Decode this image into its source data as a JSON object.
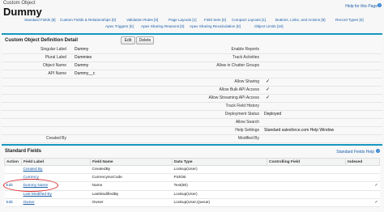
{
  "header": {
    "object_type": "Custom Object",
    "object_name": "Dummy",
    "help_link": "Help for this Page",
    "help_icon": "?"
  },
  "nav_links": {
    "row1": [
      "Standard Fields [9]",
      "Custom Fields & Relationships [0]",
      "Validation Rules [0]",
      "Page Layouts [1]",
      "Field Sets [0]",
      "Compact Layouts [1]",
      "Buttons, Links, and Actions [8]",
      "Record Types [0]"
    ],
    "row2": [
      "Apex Triggers [0]",
      "Apex Sharing Reasons [0]",
      "Apex Sharing Recalculation [0]",
      "Object Limits [10]"
    ]
  },
  "detail": {
    "title": "Custom Object Definition Detail",
    "edit_label": "Edit",
    "delete_label": "Delete",
    "left": [
      {
        "label": "Singular Label",
        "value": "Dummy"
      },
      {
        "label": "Plural Label",
        "value": "Dummies"
      },
      {
        "label": "Object Name",
        "value": "Dummy"
      },
      {
        "label": "API Name",
        "value": "Dummy__c"
      }
    ],
    "right": [
      {
        "label": "Enable Reports",
        "value": "",
        "checked": false
      },
      {
        "label": "Track Activities",
        "value": "",
        "checked": false
      },
      {
        "label": "Allow in Chatter Groups",
        "value": "",
        "checked": false
      },
      {
        "label": "Allow Sharing",
        "value": "",
        "checked": true
      },
      {
        "label": "Allow Bulk API Access",
        "value": "",
        "checked": true
      },
      {
        "label": "Allow Streaming API Access",
        "value": "",
        "checked": true
      },
      {
        "label": "Track Field History",
        "value": "",
        "checked": false
      },
      {
        "label": "Deployment Status",
        "value": "Deployed",
        "checked": false
      },
      {
        "label": "Allow Search",
        "value": "",
        "checked": false
      },
      {
        "label": "Help Settings",
        "value": "Standard salesforce.com Help Window",
        "checked": false
      },
      {
        "label": "Modified By",
        "value": "",
        "checked": false
      }
    ],
    "created_by_label": "Created By",
    "check_glyph": "✓"
  },
  "standard_fields": {
    "title": "Standard Fields",
    "help_link": "Standard Fields Help",
    "help_icon": "?",
    "columns": [
      "Action",
      "Field Label",
      "Field Name",
      "Data Type",
      "Controlling Field",
      "Indexed"
    ],
    "rows": [
      {
        "action": "",
        "label": "Created By",
        "name": "CreatedBy",
        "type": "Lookup(User)",
        "controlling": "",
        "indexed": ""
      },
      {
        "action": "",
        "label": "Currency",
        "name": "CurrencyIsoCode",
        "type": "Picklist",
        "controlling": "",
        "indexed": ""
      },
      {
        "action": "Edit",
        "label": "Dummy Name",
        "name": "Name",
        "type": "Text(80)",
        "controlling": "",
        "indexed": "✓"
      },
      {
        "action": "",
        "label": "Last Modified By",
        "name": "LastModifiedBy",
        "type": "Lookup(User)",
        "controlling": "",
        "indexed": ""
      },
      {
        "action": "Edit",
        "label": "Owner",
        "name": "Owner",
        "type": "Lookup(User,Queue)",
        "controlling": "",
        "indexed": "✓"
      }
    ]
  }
}
